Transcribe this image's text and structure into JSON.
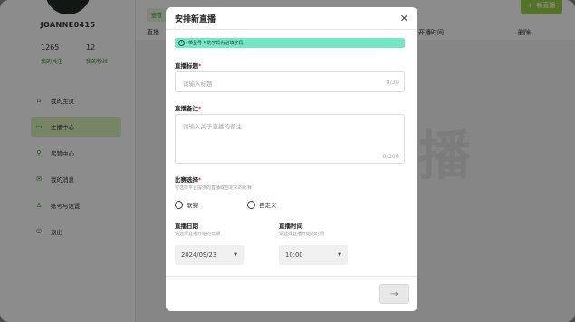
{
  "profile": {
    "username": "JOANNE0415",
    "following_count": "1265",
    "following_label": "我的关注",
    "fans_count": "12",
    "fans_label": "我的粉丝"
  },
  "sidebar": {
    "items": [
      {
        "label": "我的主页",
        "icon": "home-icon",
        "glyph": "⌂",
        "active": false
      },
      {
        "label": "主播中心",
        "icon": "broadcast-icon",
        "glyph": "▭",
        "active": true
      },
      {
        "label": "房管中心",
        "icon": "room-manage-icon",
        "glyph": "⚲",
        "active": false
      },
      {
        "label": "我的消息",
        "icon": "mail-icon",
        "glyph": "✉",
        "active": false
      },
      {
        "label": "账号与设置",
        "icon": "user-icon",
        "glyph": "♙",
        "active": false
      },
      {
        "label": "退出",
        "icon": "logout-icon",
        "glyph": "⏻",
        "active": false
      }
    ]
  },
  "content": {
    "breadcrumb": "查看",
    "col_live": "直播",
    "col_start_time": "开播时间",
    "col_delete": "删除",
    "new_button_label": "新直播",
    "watermark": "播"
  },
  "modal": {
    "title": "安排新直播",
    "notice": "带星号 * 的字段为必填字段",
    "title_field": {
      "label": "直播标题",
      "placeholder": "请输入标题",
      "counter": "0/30"
    },
    "note_field": {
      "label": "直播备注",
      "placeholder": "请输入关于直播的备注",
      "counter": "0/300"
    },
    "match_select": {
      "label": "比赛选择",
      "hint": "可选择平台提供的直播或自定义的比赛",
      "options": [
        "联赛",
        "自定义"
      ]
    },
    "date_field": {
      "label": "直播日期",
      "hint": "请选择直播开始的日期",
      "value": "2024/09/23"
    },
    "time_field": {
      "label": "直播时间",
      "hint": "请选择直播开始的时间",
      "value": "10:00"
    }
  },
  "colors": {
    "accent": "#9bd24a",
    "banner": "#76e7c6",
    "required": "#d43a3a"
  }
}
